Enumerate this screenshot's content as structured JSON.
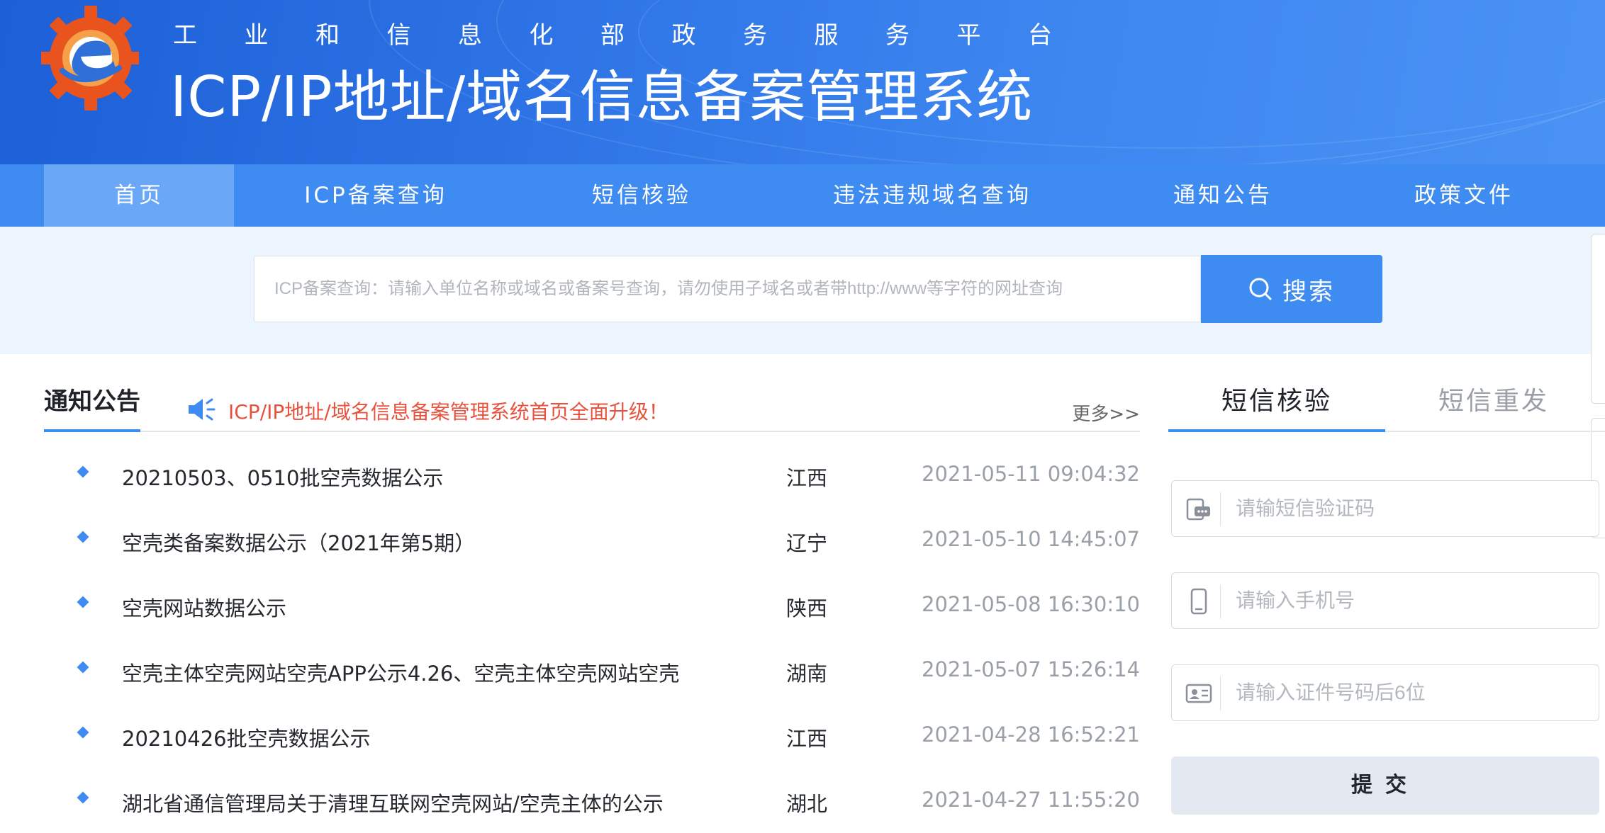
{
  "header": {
    "portal_name_chars": [
      "工",
      "业",
      "和",
      "信",
      "息",
      "化",
      "部",
      "政",
      "务",
      "服",
      "务",
      "平",
      "台"
    ],
    "system_title": "ICP/IP地址/域名信息备案管理系统"
  },
  "nav": {
    "items": [
      {
        "label": "首页",
        "active": true
      },
      {
        "label": "ICP备案查询",
        "active": false
      },
      {
        "label": "短信核验",
        "active": false
      },
      {
        "label": "违法违规域名查询",
        "active": false
      },
      {
        "label": "通知公告",
        "active": false
      },
      {
        "label": "政策文件",
        "active": false
      }
    ]
  },
  "search": {
    "placeholder": "ICP备案查询：请输入单位名称或域名或备案号查询，请勿使用子域名或者带http://www等字符的网址查询",
    "value": "",
    "button_label": "搜索"
  },
  "notices": {
    "title": "通知公告",
    "ticker": "ICP/IP地址/域名信息备案管理系统首页全面升级！",
    "more": "更多>>",
    "rows": [
      {
        "title": "20210503、0510批空壳数据公示",
        "province": "江西",
        "time": "2021-05-11 09:04:32"
      },
      {
        "title": "空壳类备案数据公示（2021年第5期）",
        "province": "辽宁",
        "time": "2021-05-10 14:45:07"
      },
      {
        "title": "空壳网站数据公示",
        "province": "陕西",
        "time": "2021-05-08 16:30:10"
      },
      {
        "title": "空壳主体空壳网站空壳APP公示4.26、空壳主体空壳网站空壳",
        "province": "湖南",
        "time": "2021-05-07 15:26:14"
      },
      {
        "title": "20210426批空壳数据公示",
        "province": "江西",
        "time": "2021-04-28 16:52:21"
      },
      {
        "title": "湖北省通信管理局关于清理互联网空壳网站/空壳主体的公示",
        "province": "湖北",
        "time": "2021-04-27 11:55:20"
      }
    ]
  },
  "sms": {
    "tabs": [
      "短信核验",
      "短信重发"
    ],
    "fields": [
      {
        "placeholder": "请输短信验证码",
        "icon": "sms-code-icon"
      },
      {
        "placeholder": "请输入手机号",
        "icon": "mobile-phone-icon"
      },
      {
        "placeholder": "请输入证件号码后6位",
        "icon": "id-card-icon"
      }
    ],
    "submit_label": "提交"
  },
  "colors": {
    "primary": "#3e8bf2",
    "nav_active": "#6aa7f6",
    "ticker": "#e8513d",
    "banner_dark": "#1d5fd6"
  }
}
